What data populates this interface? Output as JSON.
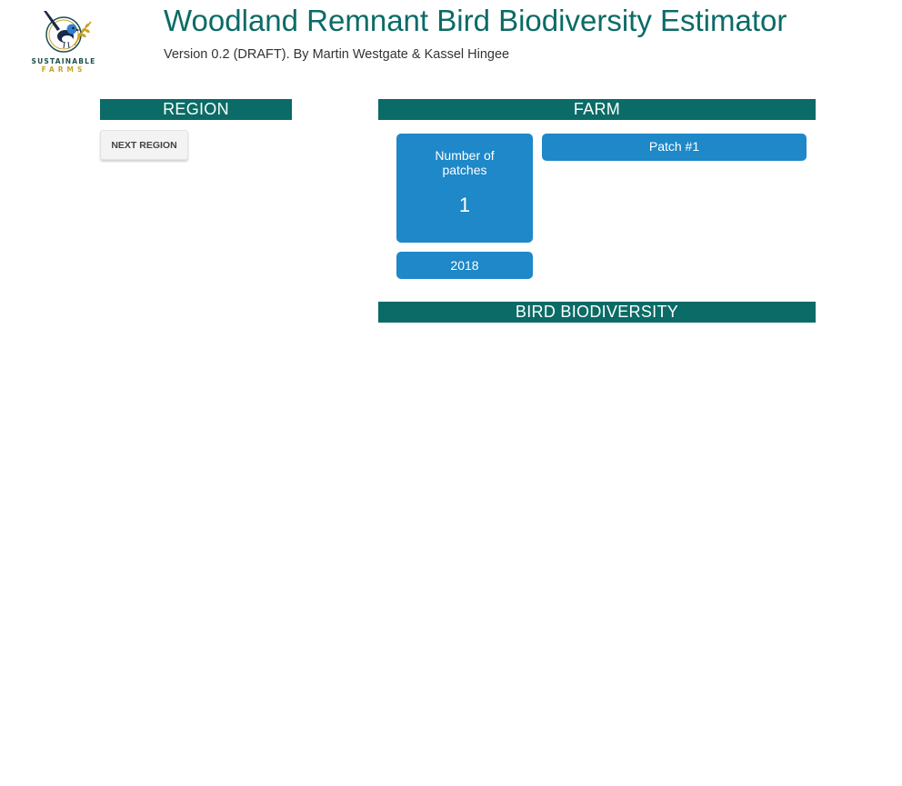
{
  "logo": {
    "line1": "SUSTAINABLE",
    "line2": "FARMS"
  },
  "header": {
    "title": "Woodland Remnant Bird Biodiversity Estimator",
    "subtitle": "Version 0.2 (DRAFT). By Martin Westgate & Kassel Hingee"
  },
  "region": {
    "heading": "REGION",
    "next_button": "NEXT REGION"
  },
  "farm": {
    "heading": "FARM",
    "patches_label": "Number of patches",
    "patches_value": "1",
    "year": "2018",
    "patch_tab": "Patch #1"
  },
  "bird": {
    "heading": "BIRD BIODIVERSITY"
  },
  "colors": {
    "teal": "#0b6b66",
    "blue": "#1e88c8",
    "gold": "#c9a227"
  }
}
